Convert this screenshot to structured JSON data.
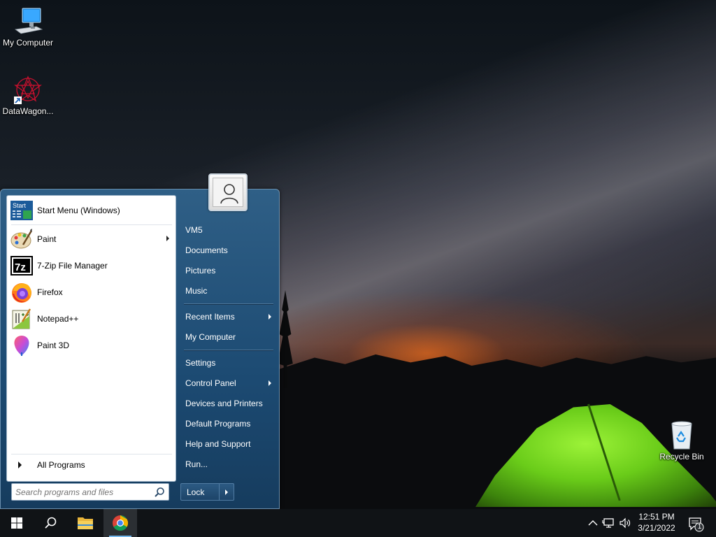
{
  "desktop": {
    "icons": [
      {
        "label": "My Computer",
        "icon": "computer-icon"
      },
      {
        "label": "DataWagon...",
        "icon": "datawagon-icon"
      },
      {
        "label": "Recycle Bin",
        "icon": "recycle-bin-icon"
      }
    ]
  },
  "start_menu": {
    "pinned": {
      "label": "Start Menu (Windows)",
      "icon": "start-menu-icon",
      "icon_text": "Start"
    },
    "programs": [
      {
        "label": "Paint",
        "icon": "paint-icon",
        "submenu": true
      },
      {
        "label": "7-Zip File Manager",
        "icon": "7zip-icon",
        "icon_text": "7z"
      },
      {
        "label": "Firefox",
        "icon": "firefox-icon"
      },
      {
        "label": "Notepad++",
        "icon": "notepadpp-icon"
      },
      {
        "label": "Paint 3D",
        "icon": "paint3d-icon"
      }
    ],
    "all_programs": "All Programs",
    "search_placeholder": "Search programs and files",
    "right_items": [
      {
        "label": "VM5"
      },
      {
        "label": "Documents"
      },
      {
        "label": "Pictures"
      },
      {
        "label": "Music"
      },
      {
        "label": "Recent Items",
        "submenu": true
      },
      {
        "label": "My Computer"
      },
      {
        "label": "Settings"
      },
      {
        "label": "Control Panel",
        "submenu": true
      },
      {
        "label": "Devices and Printers"
      },
      {
        "label": "Default Programs"
      },
      {
        "label": "Help and Support"
      },
      {
        "label": "Run..."
      }
    ],
    "lock_label": "Lock"
  },
  "taskbar": {
    "buttons": [
      {
        "icon": "windows-start-icon"
      },
      {
        "icon": "search-icon"
      },
      {
        "icon": "file-explorer-icon"
      },
      {
        "icon": "chrome-icon",
        "active": true
      }
    ],
    "tray": {
      "time": "12:51 PM",
      "date": "3/21/2022",
      "notification_count": "1"
    }
  },
  "colors": {
    "menu_blue": "#1c4a72",
    "taskbar": "#101316",
    "accent": "#76b9ed"
  }
}
